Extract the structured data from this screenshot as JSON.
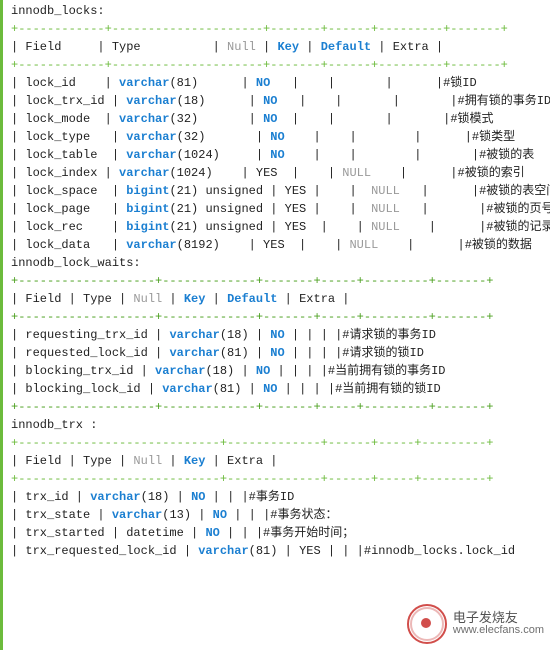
{
  "tables": {
    "locks": {
      "name": "innodb_locks:",
      "header_columns": "| Field     | Type          | Null | Key | Default | Extra |",
      "rows": [
        {
          "text": "| lock_id    | varchar(81)      | NO   |     |        |       |#锁ID"
        },
        {
          "text": "| lock_trx_id | varchar(18)      | NO   |     |        |        |#拥有锁的事务ID"
        },
        {
          "text": "| lock_mode  | varchar(32)       | NO  |     |        |        |#锁模式"
        },
        {
          "text": "| lock_type   | varchar(32)       | NO    |     |         |       |#锁类型"
        },
        {
          "text": "| lock_table  | varchar(1024)     | NO    |     |         |        |#被锁的表"
        },
        {
          "text": "| lock_index | varchar(1024)    | YES  |     | NULL    |       |#被锁的索引"
        },
        {
          "text": "| lock_space  | bigint(21) unsigned | YES |     |  NULL   |       |#被锁的表空间号"
        },
        {
          "text": "| lock_page   | bigint(21) unsigned | YES |     |  NULL   |        |#被锁的页号"
        },
        {
          "text": "| lock_rec    | bigint(21) unsigned | YES  |     | NULL    |       |#被锁的记录号"
        },
        {
          "text": "| lock_data   | varchar(8192)    | YES  |     | NULL    |       |#被锁的数据"
        }
      ]
    },
    "lock_waits": {
      "name": "innodb_lock_waits:",
      "header_columns": "| Field | Type | Null | Key | Default | Extra |",
      "rows": [
        {
          "text": "| requesting_trx_id | varchar(18) | NO | | | |#请求锁的事务ID"
        },
        {
          "text": "| requested_lock_id | varchar(81) | NO | | | |#请求锁的锁ID"
        },
        {
          "text": "| blocking_trx_id | varchar(18) | NO | | | |#当前拥有锁的事务ID"
        },
        {
          "text": "| blocking_lock_id | varchar(81) | NO | | | |#当前拥有锁的锁ID"
        }
      ]
    },
    "trx": {
      "name": "innodb_trx :",
      "header_columns": "| Field | Type | Null | Key | Extra |",
      "rows": [
        {
          "text": "| trx_id | varchar(18) | NO | | |#事务ID"
        },
        {
          "text": "| trx_state | varchar(13) | NO | | |#事务状态："
        },
        {
          "text": "| trx_started | datetime | NO | | |#事务开始时间；"
        },
        {
          "text": "| trx_requested_lock_id | varchar(81) | YES | | |#innodb_locks.lock_id"
        }
      ]
    }
  },
  "separator_long": "+------------+---------------------+-------+------+---------+-------+",
  "separator_med": "+-------------------+-------------+-------+-----+---------+-------+",
  "separator_short": "+----------------------------+-------------+------+-----+---------+",
  "watermark": {
    "cn": "电子发烧友",
    "url": "www.elecfans.com"
  }
}
